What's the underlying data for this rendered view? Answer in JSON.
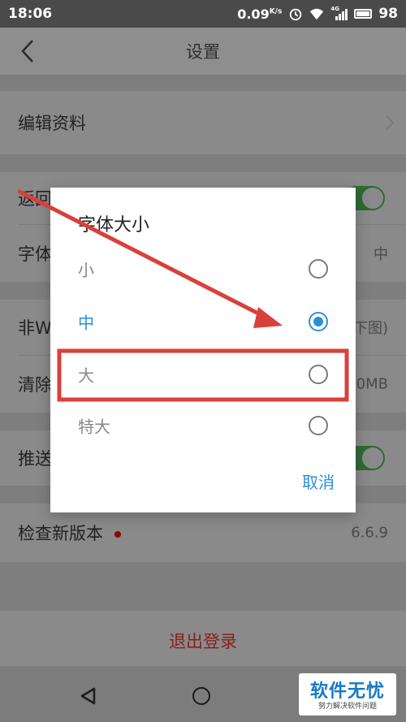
{
  "status_bar": {
    "time": "18:06",
    "speed": "0.09",
    "speed_unit": "K/s",
    "signal_label": "4G",
    "battery": "98"
  },
  "navbar": {
    "title": "设置"
  },
  "settings": {
    "edit_profile": "编辑资料",
    "return_row_label": "返回",
    "font_row_label": "字体",
    "font_row_value": "中",
    "nonwifi_row_label": "非W",
    "nonwifi_row_value": "下图)",
    "clear_row_label": "清除",
    "clear_row_value": "0MB",
    "push_row_label": "推送",
    "check_version_label": "检查新版本",
    "check_version_value": "6.6.9",
    "logout": "退出登录"
  },
  "dialog": {
    "title": "字体大小",
    "options": [
      {
        "label": "小",
        "selected": false
      },
      {
        "label": "中",
        "selected": true
      },
      {
        "label": "大",
        "selected": false
      },
      {
        "label": "特大",
        "selected": false
      }
    ],
    "cancel": "取消"
  },
  "colors": {
    "accent": "#2b8fd6",
    "annotation": "#d9403a",
    "toggle_on": "#2f6a33"
  },
  "watermark": {
    "main": "软件无忧",
    "sub": "努力解决软件问题"
  }
}
